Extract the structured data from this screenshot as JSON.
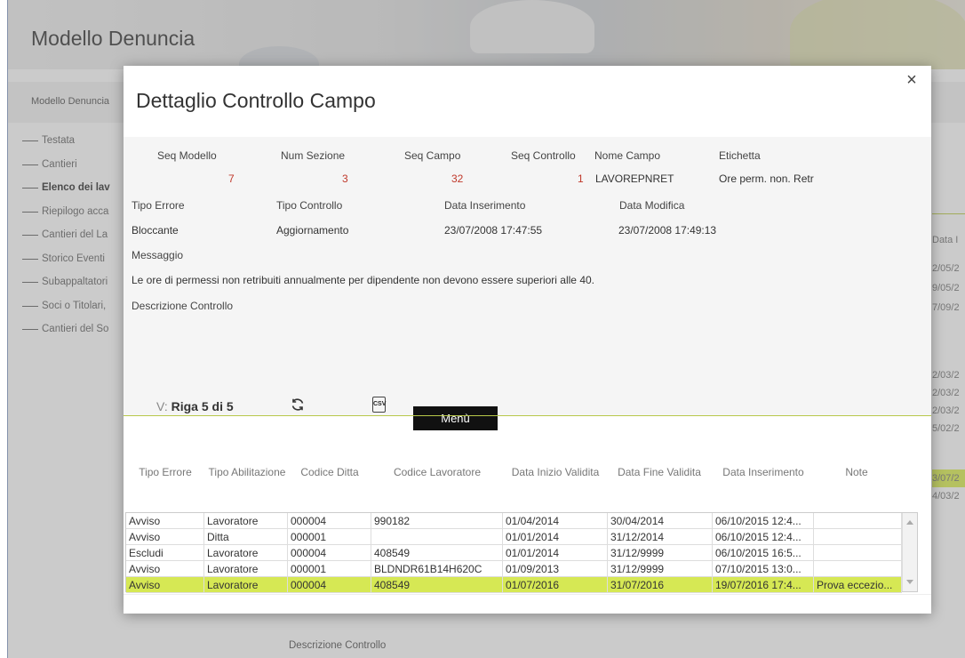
{
  "background": {
    "page_title": "Modello Denuncia",
    "breadcrumb": "Modello Denuncia",
    "nav": [
      "Testata",
      "Cantieri",
      "Elenco dei lav",
      "Riepilogo acca",
      "Cantieri del La",
      "Storico Eventi",
      "Subappaltatori",
      "Soci o Titolari,",
      "Cantieri del So"
    ],
    "right_header": "Data I",
    "right_cells": [
      "2/05/2",
      "9/05/2",
      "7/09/2",
      "2/03/2",
      "2/03/2",
      "2/03/2",
      "5/02/2",
      "3/07/2",
      "4/03/2"
    ],
    "footer_label": "Descrizione Controllo"
  },
  "modal": {
    "title": "Dettaglio Controllo Campo",
    "close": "×",
    "fields_row1": {
      "seq_modello_label": "Seq Modello",
      "num_sezione_label": "Num Sezione",
      "seq_campo_label": "Seq Campo",
      "seq_controllo_label": "Seq Controllo",
      "nome_campo_label": "Nome Campo",
      "etichetta_label": "Etichetta",
      "seq_modello": "7",
      "num_sezione": "3",
      "seq_campo": "32",
      "seq_controllo": "1",
      "nome_campo": "LAVOREPNRET",
      "etichetta": "Ore perm. non. Retr"
    },
    "fields_row2": {
      "tipo_errore_label": "Tipo Errore",
      "tipo_controllo_label": "Tipo Controllo",
      "data_inserimento_label": "Data Inserimento",
      "data_modifica_label": "Data Modifica",
      "tipo_errore": "Bloccante",
      "tipo_controllo": "Aggiornamento",
      "data_inserimento": "23/07/2008 17:47:55",
      "data_modifica": "23/07/2008 17:49:13"
    },
    "messaggio_label": "Messaggio",
    "messaggio": "Le ore di permessi non retribuiti annualmente per dipendente non devono essere superiori alle 40.",
    "descrizione_label": "Descrizione Controllo",
    "toolbar": {
      "riga_prefix": "V:",
      "riga_text": "Riga 5 di 5",
      "csv_label": "CSV",
      "menu_label": "Menù"
    },
    "table": {
      "headers": [
        "Tipo Errore",
        "Tipo Abilitazione",
        "Codice Ditta",
        "Codice Lavoratore",
        "Data Inizio Validita",
        "Data Fine Validita",
        "Data Inserimento",
        "Note"
      ],
      "rows": [
        [
          "Avviso",
          "Lavoratore",
          "000004",
          "990182",
          "01/04/2014",
          "30/04/2014",
          "06/10/2015 12:4...",
          ""
        ],
        [
          "Avviso",
          "Ditta",
          "000001",
          "",
          "01/01/2014",
          "31/12/2014",
          "06/10/2015 12:4...",
          ""
        ],
        [
          "Escludi",
          "Lavoratore",
          "000004",
          "408549",
          "01/01/2014",
          "31/12/9999",
          "06/10/2015 16:5...",
          ""
        ],
        [
          "Avviso",
          "Lavoratore",
          "000001",
          "BLDNDR61B14H620C",
          "01/09/2013",
          "31/12/9999",
          "07/10/2015 13:0...",
          ""
        ],
        [
          "Avviso",
          "Lavoratore",
          "000004",
          "408549",
          "01/07/2016",
          "31/07/2016",
          "19/07/2016 17:4...",
          "Prova eccezio..."
        ]
      ],
      "selected_row": 4
    },
    "colors": {
      "highlight": "#d6e854",
      "accent_line": "#b8c84a",
      "red_value": "#c0392b"
    }
  }
}
